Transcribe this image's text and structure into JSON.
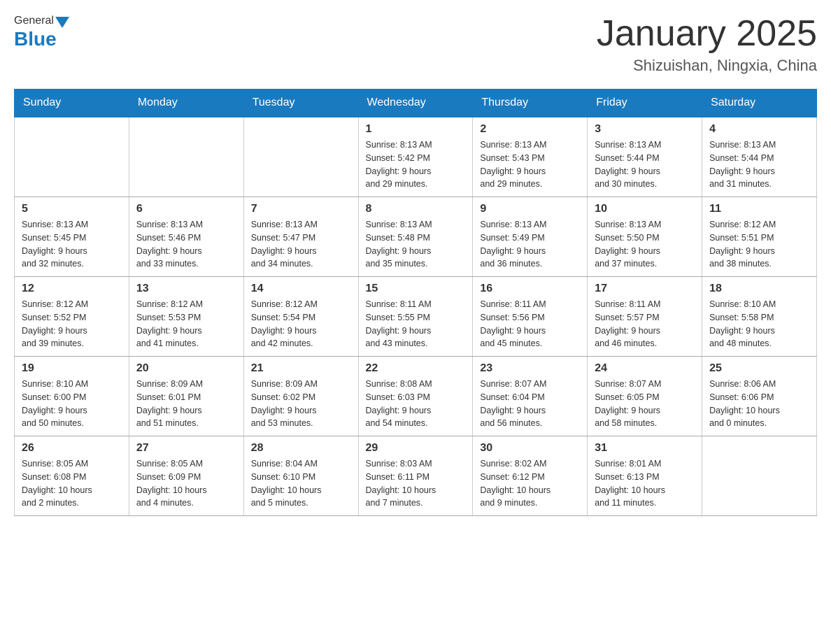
{
  "header": {
    "logo_general": "General",
    "logo_blue": "Blue",
    "title": "January 2025",
    "subtitle": "Shizuishan, Ningxia, China"
  },
  "days_of_week": [
    "Sunday",
    "Monday",
    "Tuesday",
    "Wednesday",
    "Thursday",
    "Friday",
    "Saturday"
  ],
  "weeks": [
    [
      {
        "day": "",
        "info": ""
      },
      {
        "day": "",
        "info": ""
      },
      {
        "day": "",
        "info": ""
      },
      {
        "day": "1",
        "info": "Sunrise: 8:13 AM\nSunset: 5:42 PM\nDaylight: 9 hours\nand 29 minutes."
      },
      {
        "day": "2",
        "info": "Sunrise: 8:13 AM\nSunset: 5:43 PM\nDaylight: 9 hours\nand 29 minutes."
      },
      {
        "day": "3",
        "info": "Sunrise: 8:13 AM\nSunset: 5:44 PM\nDaylight: 9 hours\nand 30 minutes."
      },
      {
        "day": "4",
        "info": "Sunrise: 8:13 AM\nSunset: 5:44 PM\nDaylight: 9 hours\nand 31 minutes."
      }
    ],
    [
      {
        "day": "5",
        "info": "Sunrise: 8:13 AM\nSunset: 5:45 PM\nDaylight: 9 hours\nand 32 minutes."
      },
      {
        "day": "6",
        "info": "Sunrise: 8:13 AM\nSunset: 5:46 PM\nDaylight: 9 hours\nand 33 minutes."
      },
      {
        "day": "7",
        "info": "Sunrise: 8:13 AM\nSunset: 5:47 PM\nDaylight: 9 hours\nand 34 minutes."
      },
      {
        "day": "8",
        "info": "Sunrise: 8:13 AM\nSunset: 5:48 PM\nDaylight: 9 hours\nand 35 minutes."
      },
      {
        "day": "9",
        "info": "Sunrise: 8:13 AM\nSunset: 5:49 PM\nDaylight: 9 hours\nand 36 minutes."
      },
      {
        "day": "10",
        "info": "Sunrise: 8:13 AM\nSunset: 5:50 PM\nDaylight: 9 hours\nand 37 minutes."
      },
      {
        "day": "11",
        "info": "Sunrise: 8:12 AM\nSunset: 5:51 PM\nDaylight: 9 hours\nand 38 minutes."
      }
    ],
    [
      {
        "day": "12",
        "info": "Sunrise: 8:12 AM\nSunset: 5:52 PM\nDaylight: 9 hours\nand 39 minutes."
      },
      {
        "day": "13",
        "info": "Sunrise: 8:12 AM\nSunset: 5:53 PM\nDaylight: 9 hours\nand 41 minutes."
      },
      {
        "day": "14",
        "info": "Sunrise: 8:12 AM\nSunset: 5:54 PM\nDaylight: 9 hours\nand 42 minutes."
      },
      {
        "day": "15",
        "info": "Sunrise: 8:11 AM\nSunset: 5:55 PM\nDaylight: 9 hours\nand 43 minutes."
      },
      {
        "day": "16",
        "info": "Sunrise: 8:11 AM\nSunset: 5:56 PM\nDaylight: 9 hours\nand 45 minutes."
      },
      {
        "day": "17",
        "info": "Sunrise: 8:11 AM\nSunset: 5:57 PM\nDaylight: 9 hours\nand 46 minutes."
      },
      {
        "day": "18",
        "info": "Sunrise: 8:10 AM\nSunset: 5:58 PM\nDaylight: 9 hours\nand 48 minutes."
      }
    ],
    [
      {
        "day": "19",
        "info": "Sunrise: 8:10 AM\nSunset: 6:00 PM\nDaylight: 9 hours\nand 50 minutes."
      },
      {
        "day": "20",
        "info": "Sunrise: 8:09 AM\nSunset: 6:01 PM\nDaylight: 9 hours\nand 51 minutes."
      },
      {
        "day": "21",
        "info": "Sunrise: 8:09 AM\nSunset: 6:02 PM\nDaylight: 9 hours\nand 53 minutes."
      },
      {
        "day": "22",
        "info": "Sunrise: 8:08 AM\nSunset: 6:03 PM\nDaylight: 9 hours\nand 54 minutes."
      },
      {
        "day": "23",
        "info": "Sunrise: 8:07 AM\nSunset: 6:04 PM\nDaylight: 9 hours\nand 56 minutes."
      },
      {
        "day": "24",
        "info": "Sunrise: 8:07 AM\nSunset: 6:05 PM\nDaylight: 9 hours\nand 58 minutes."
      },
      {
        "day": "25",
        "info": "Sunrise: 8:06 AM\nSunset: 6:06 PM\nDaylight: 10 hours\nand 0 minutes."
      }
    ],
    [
      {
        "day": "26",
        "info": "Sunrise: 8:05 AM\nSunset: 6:08 PM\nDaylight: 10 hours\nand 2 minutes."
      },
      {
        "day": "27",
        "info": "Sunrise: 8:05 AM\nSunset: 6:09 PM\nDaylight: 10 hours\nand 4 minutes."
      },
      {
        "day": "28",
        "info": "Sunrise: 8:04 AM\nSunset: 6:10 PM\nDaylight: 10 hours\nand 5 minutes."
      },
      {
        "day": "29",
        "info": "Sunrise: 8:03 AM\nSunset: 6:11 PM\nDaylight: 10 hours\nand 7 minutes."
      },
      {
        "day": "30",
        "info": "Sunrise: 8:02 AM\nSunset: 6:12 PM\nDaylight: 10 hours\nand 9 minutes."
      },
      {
        "day": "31",
        "info": "Sunrise: 8:01 AM\nSunset: 6:13 PM\nDaylight: 10 hours\nand 11 minutes."
      },
      {
        "day": "",
        "info": ""
      }
    ]
  ]
}
